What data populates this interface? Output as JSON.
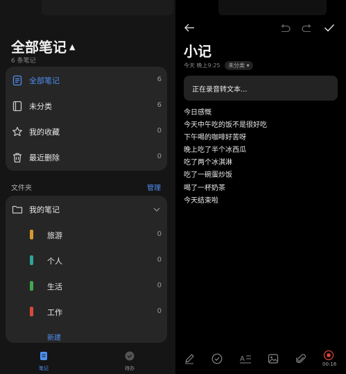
{
  "left": {
    "title": "全部笔记",
    "count": "6 条笔记",
    "categories": [
      {
        "label": "全部笔记",
        "count": "6"
      },
      {
        "label": "未分类",
        "count": "6"
      },
      {
        "label": "我的收藏",
        "count": "0"
      },
      {
        "label": "最近删除",
        "count": "0"
      }
    ],
    "folder_section_label": "文件夹",
    "manage_label": "管理",
    "folders": {
      "root": "我的笔记",
      "items": [
        {
          "label": "旅游",
          "count": "0",
          "color": "#d49a2e"
        },
        {
          "label": "个人",
          "count": "0",
          "color": "#2fa59a"
        },
        {
          "label": "生活",
          "count": "0",
          "color": "#3fa84f"
        },
        {
          "label": "工作",
          "count": "0",
          "color": "#d9483b"
        }
      ]
    },
    "new_folder_label": "新建",
    "tabs": {
      "notes": "笔记",
      "todo": "待办"
    }
  },
  "right": {
    "title": "小记",
    "time": "今天 晚上9:25",
    "category": "未分类",
    "status": "正在录音转文本...",
    "lines": [
      "今日感慨",
      "今天中午吃的饭不是很好吃",
      "下午喝的咖啡好苦呀",
      "晚上吃了半个冰西瓜",
      "吃了两个冰淇淋",
      "吃了一碗蛋炒饭",
      "喝了一杯奶茶",
      "今天结束啦"
    ],
    "record_time": "00:16"
  },
  "colors": {
    "accent": "#4f8ff0",
    "record": "#e0493a"
  }
}
